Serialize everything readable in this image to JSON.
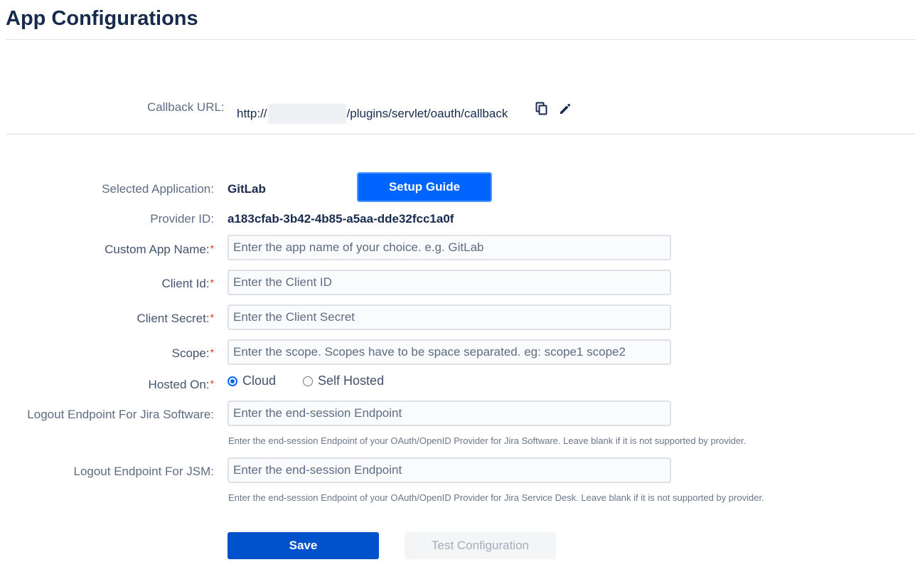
{
  "page": {
    "title": "App Configurations"
  },
  "callback": {
    "label": "Callback URL:",
    "url_prefix": "http://",
    "url_suffix": "/plugins/servlet/oauth/callback",
    "icons": [
      "copy-icon",
      "edit-pencil-icon"
    ]
  },
  "app": {
    "selected_label": "Selected Application:",
    "selected_value": "GitLab",
    "setup_guide_label": "Setup Guide",
    "provider_label": "Provider ID:",
    "provider_value": "a183cfab-3b42-4b85-a5aa-dde32fcc1a0f"
  },
  "form": {
    "custom_app_name": {
      "label": "Custom App Name:",
      "value": "",
      "placeholder": "Enter the app name of your choice. e.g. GitLab"
    },
    "client_id": {
      "label": "Client Id:",
      "value": "",
      "placeholder": "Enter the Client ID"
    },
    "client_secret": {
      "label": "Client Secret:",
      "value": "",
      "placeholder": "Enter the Client Secret"
    },
    "scope": {
      "label": "Scope:",
      "value": "",
      "placeholder": "Enter the scope. Scopes have to be space separated. eg: scope1 scope2"
    },
    "hosted_on": {
      "label": "Hosted On:",
      "options": [
        "Cloud",
        "Self Hosted"
      ],
      "selected": "Cloud"
    },
    "logout_jira": {
      "label": "Logout Endpoint For Jira Software:",
      "value": "",
      "placeholder": "Enter the end-session Endpoint",
      "help": "Enter the end-session Endpoint of your OAuth/OpenID Provider for Jira Software. Leave blank if it is not supported by provider."
    },
    "logout_jsm": {
      "label": "Logout Endpoint For JSM:",
      "value": "",
      "placeholder": "Enter the end-session Endpoint",
      "help": "Enter the end-session Endpoint of your OAuth/OpenID Provider for Jira Service Desk. Leave blank if it is not supported by provider."
    },
    "required_marker": "*"
  },
  "actions": {
    "save_label": "Save",
    "test_label": "Test Configuration"
  },
  "colors": {
    "primary": "#0052cc",
    "setup_button": "#0065ff",
    "required": "#de350b",
    "text": "#172b4d"
  }
}
